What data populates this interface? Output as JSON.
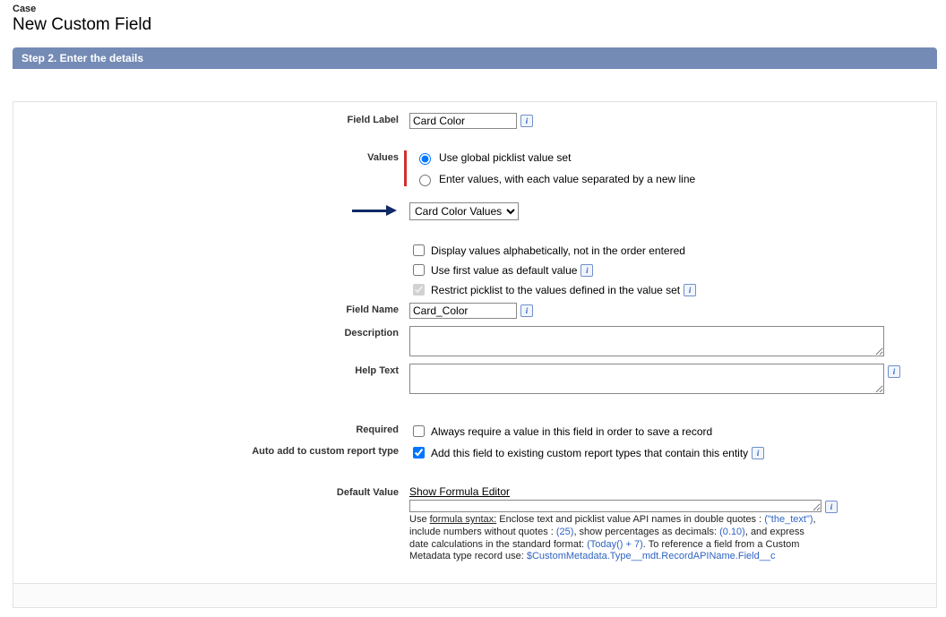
{
  "header": {
    "object": "Case",
    "title": "New Custom Field"
  },
  "step_bar": "Step 2. Enter the details",
  "labels": {
    "field_label": "Field Label",
    "values": "Values",
    "field_name": "Field Name",
    "description": "Description",
    "help_text": "Help Text",
    "required": "Required",
    "auto_add": "Auto add to custom report type",
    "default_value": "Default Value"
  },
  "fields": {
    "field_label": {
      "value": "Card Color"
    },
    "field_name": {
      "value": "Card_Color"
    },
    "description": {
      "value": ""
    },
    "help_text": {
      "value": ""
    },
    "default_value_expr": {
      "value": ""
    }
  },
  "radios": {
    "global": "Use global picklist value set",
    "enter": "Enter values, with each value separated by a new line"
  },
  "select": {
    "global_set": "Card Color Values"
  },
  "checkboxes": {
    "alpha": "Display values alphabetically, not in the order entered",
    "first_default": "Use first value as default value",
    "restrict": "Restrict picklist to the values defined in the value set",
    "required": "Always require a value in this field in order to save a record",
    "auto_add": "Add this field to existing custom report types that contain this entity"
  },
  "default_value": {
    "link": "Show Formula Editor",
    "hint_pre": "Use ",
    "hint_link": "formula syntax:",
    "hint_1": " Enclose text and picklist value API names in double quotes : ",
    "hint_ex1": "(\"the_text\")",
    "hint_2": ", include numbers without quotes : ",
    "hint_ex2": "(25)",
    "hint_3": ", show percentages as decimals: ",
    "hint_ex3": "(0.10)",
    "hint_4": ", and express date calculations in the standard format: ",
    "hint_ex4": "(Today() + 7)",
    "hint_5": ". To reference a field from a Custom Metadata type record use: ",
    "hint_ex5": "$CustomMetadata.Type__mdt.RecordAPIName.Field__c"
  }
}
